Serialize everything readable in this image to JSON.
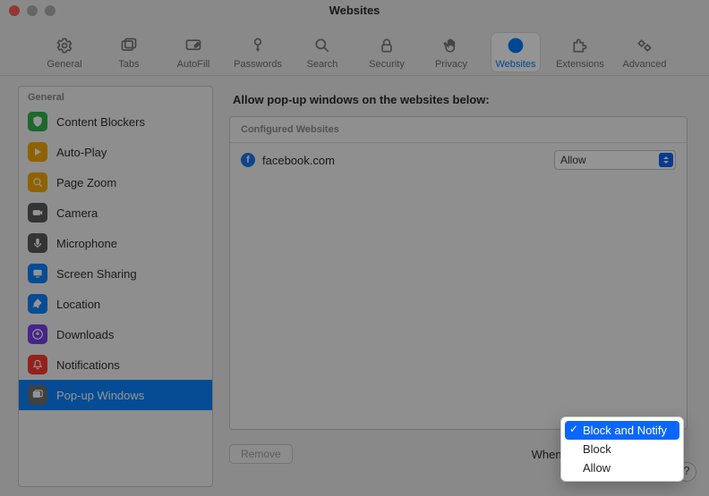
{
  "window": {
    "title": "Websites"
  },
  "toolbar": {
    "items": [
      {
        "label": "General"
      },
      {
        "label": "Tabs"
      },
      {
        "label": "AutoFill"
      },
      {
        "label": "Passwords"
      },
      {
        "label": "Search"
      },
      {
        "label": "Security"
      },
      {
        "label": "Privacy"
      },
      {
        "label": "Websites"
      },
      {
        "label": "Extensions"
      },
      {
        "label": "Advanced"
      }
    ],
    "active_index": 7
  },
  "sidebar": {
    "header": "General",
    "items": [
      {
        "label": "Content Blockers",
        "color": "#33b44a"
      },
      {
        "label": "Auto-Play",
        "color": "#f7a900"
      },
      {
        "label": "Page Zoom",
        "color": "#f7a900"
      },
      {
        "label": "Camera",
        "color": "#5a5a5a"
      },
      {
        "label": "Microphone",
        "color": "#5a5a5a"
      },
      {
        "label": "Screen Sharing",
        "color": "#0a84ff"
      },
      {
        "label": "Location",
        "color": "#0a84ff"
      },
      {
        "label": "Downloads",
        "color": "#7a3ff0"
      },
      {
        "label": "Notifications",
        "color": "#ff3b30"
      },
      {
        "label": "Pop-up Windows",
        "color": "#6e6e6e"
      }
    ],
    "selected_index": 9
  },
  "main": {
    "heading": "Allow pop-up windows on the websites below:",
    "configured_header": "Configured Websites",
    "site": {
      "name": "facebook.com",
      "permission": "Allow"
    },
    "remove_label": "Remove",
    "other_label": "When visiting other websites:"
  },
  "dropdown": {
    "options": [
      "Block and Notify",
      "Block",
      "Allow"
    ],
    "selected_index": 0
  },
  "help_glyph": "?"
}
